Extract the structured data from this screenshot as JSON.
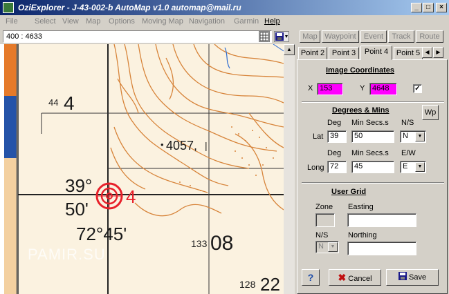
{
  "window": {
    "title": "OziExplorer  -  J-43-002-b AutoMap v1.0 automap@mail.ru",
    "minimize": "_",
    "maximize": "□",
    "close": "×"
  },
  "menu": [
    "File",
    "Select",
    "View",
    "Map",
    "Options",
    "Moving Map",
    "Navigation",
    "Garmin",
    "Help"
  ],
  "toolbar": {
    "scale": "400 : 4633",
    "buttons": [
      "Map",
      "Waypoint",
      "Event",
      "Track",
      "Route"
    ]
  },
  "map": {
    "labels": {
      "n44": "44",
      "n4": "4",
      "elev_dot": "•",
      "elev": "4057,",
      "elev_frac": "|",
      "lat_deg": "39°",
      "lat_min": "50'",
      "lon": "72°45'",
      "n133": "133",
      "n08": "08",
      "n128": "128",
      "n22": "22",
      "point_num": "4"
    },
    "marker_color": "#e8202a"
  },
  "tabs": {
    "items": [
      "Point 2",
      "Point 3",
      "Point 4",
      "Point 5"
    ],
    "selected": "Point 4"
  },
  "image_coords": {
    "heading": "Image Coordinates",
    "x_label": "X",
    "x_value": "153",
    "y_label": "Y",
    "y_value": "4648",
    "checked": "✓"
  },
  "degmin": {
    "heading": "Degrees & Mins",
    "wp_button": "Wp",
    "lat_label": "Lat",
    "long_label": "Long",
    "deg_label": "Deg",
    "min_label": "Min Secs.s",
    "ns_label": "N/S",
    "ew_label": "E/W",
    "lat_deg": "39",
    "lat_min": "50",
    "lat_ns": "N",
    "long_deg": "72",
    "long_min": "45",
    "long_ew": "E"
  },
  "user_grid": {
    "heading": "User Grid",
    "zone_label": "Zone",
    "easting_label": "Easting",
    "ns_label": "N/S",
    "northing_label": "Northing",
    "ns_value": "N"
  },
  "actions": {
    "help": "?",
    "cancel": "Cancel",
    "save": "Save"
  },
  "watermark": "PAMIR.SU"
}
